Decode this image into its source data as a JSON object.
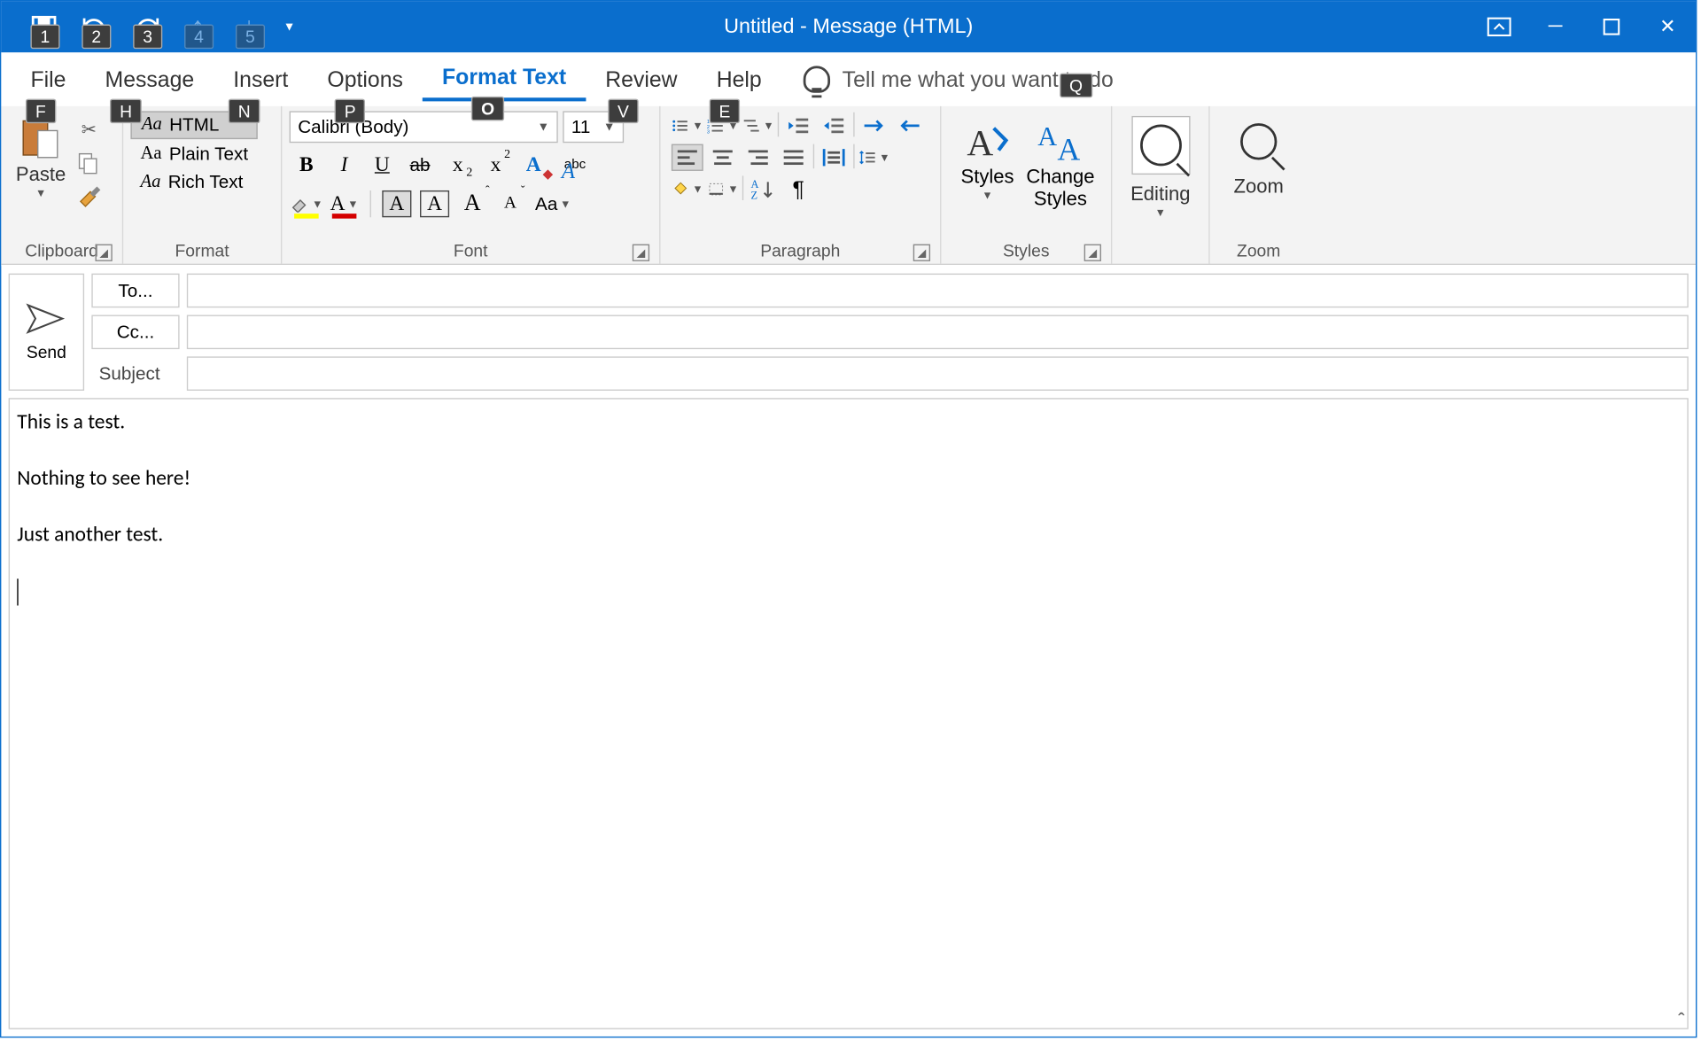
{
  "title": "Untitled  -  Message (HTML)",
  "qat_keys": [
    "1",
    "2",
    "3",
    "4",
    "5"
  ],
  "tabs": {
    "file": "File",
    "message": "Message",
    "insert": "Insert",
    "options": "Options",
    "format_text": "Format Text",
    "review": "Review",
    "help": "Help",
    "tellme": "Tell me what you want to do"
  },
  "tab_keys": {
    "file": "F",
    "message": "H",
    "insert": "N",
    "options": "P",
    "format_text": "O",
    "review": "V",
    "help": "E",
    "tellme": "Q"
  },
  "ribbon": {
    "clipboard": {
      "label": "Clipboard",
      "paste": "Paste"
    },
    "format": {
      "label": "Format",
      "html": "HTML",
      "plain": "Plain Text",
      "rich": "Rich Text",
      "aa": "Aa"
    },
    "font": {
      "label": "Font",
      "name_value": "Calibri (Body)",
      "size_value": "11",
      "bold": "B",
      "italic": "I",
      "underline": "U",
      "strike": "ab",
      "sub": "x",
      "sub2": "2",
      "sup": "x",
      "sup2": "2",
      "abc": "abc",
      "bigA": "A",
      "growA": "A",
      "growCaret": "ˆ",
      "shrinkA": "A",
      "shrinkCaret": "ˇ",
      "caseAa": "Aa"
    },
    "paragraph": {
      "label": "Paragraph"
    },
    "styles": {
      "label": "Styles",
      "styles_btn": "Styles",
      "change": "Change\nStyles"
    },
    "editing": {
      "label": "Editing",
      "btn": "Editing"
    },
    "zoom": {
      "label": "Zoom",
      "btn": "Zoom"
    }
  },
  "recipients": {
    "send": "Send",
    "to": "To...",
    "cc": "Cc...",
    "subject": "Subject"
  },
  "body_lines": [
    "This is a test.",
    "Nothing to see here!",
    "Just another test."
  ]
}
